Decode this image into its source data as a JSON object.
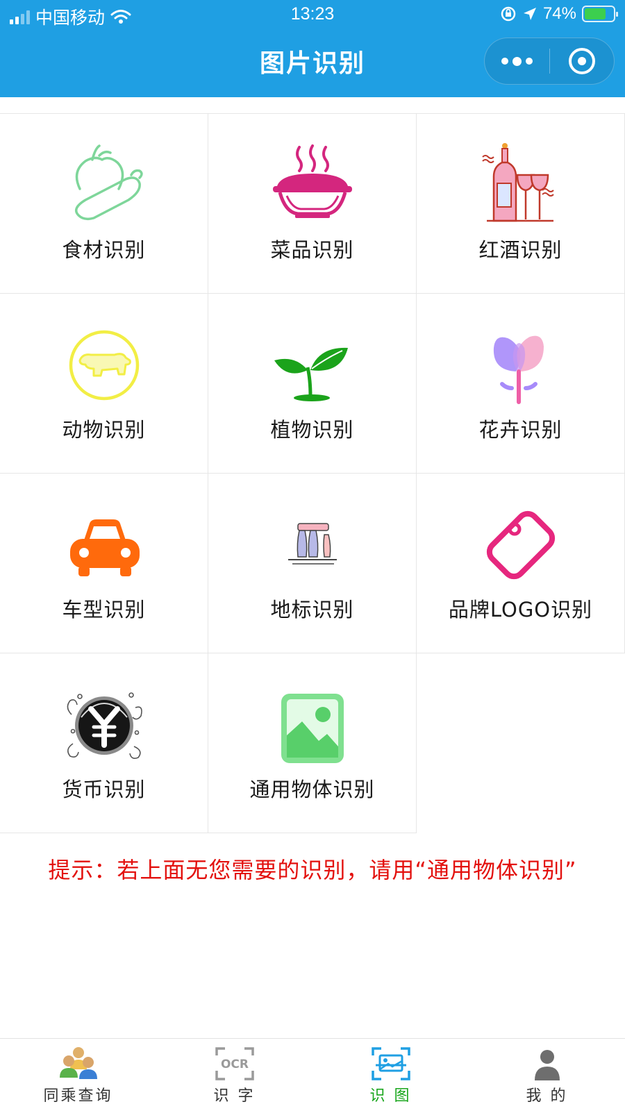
{
  "status_bar": {
    "carrier": "中国移动",
    "time": "13:23",
    "battery": "74%",
    "battery_level": 0.74
  },
  "nav": {
    "title": "图片识别"
  },
  "grid": {
    "items": [
      {
        "label": "食材识别",
        "icon": "vegetables-icon"
      },
      {
        "label": "菜品识别",
        "icon": "hot-dish-icon"
      },
      {
        "label": "红酒识别",
        "icon": "wine-bottle-icon"
      },
      {
        "label": "动物识别",
        "icon": "polar-bear-icon"
      },
      {
        "label": "植物识别",
        "icon": "seedling-icon"
      },
      {
        "label": "花卉识别",
        "icon": "tulip-icon"
      },
      {
        "label": "车型识别",
        "icon": "car-icon"
      },
      {
        "label": "地标识别",
        "icon": "stonehenge-icon"
      },
      {
        "label": "品牌LOGO识别",
        "icon": "tag-icon"
      },
      {
        "label": "货币识别",
        "icon": "yuan-coin-icon"
      },
      {
        "label": "通用物体识别",
        "icon": "image-icon"
      }
    ]
  },
  "hint": "提示：若上面无您需要的识别，请用“通用物体识别”",
  "tabbar": {
    "tabs": [
      {
        "label": "同乘查询",
        "icon": "people-icon",
        "active": false
      },
      {
        "label": "识 字",
        "icon": "ocr-icon",
        "active": false
      },
      {
        "label": "识 图",
        "icon": "scan-image-icon",
        "active": true
      },
      {
        "label": "我 的",
        "icon": "user-icon",
        "active": false
      }
    ]
  },
  "colors": {
    "header": "#1f9fe3",
    "hint": "#e3110e",
    "active_tab": "#19a61c"
  }
}
